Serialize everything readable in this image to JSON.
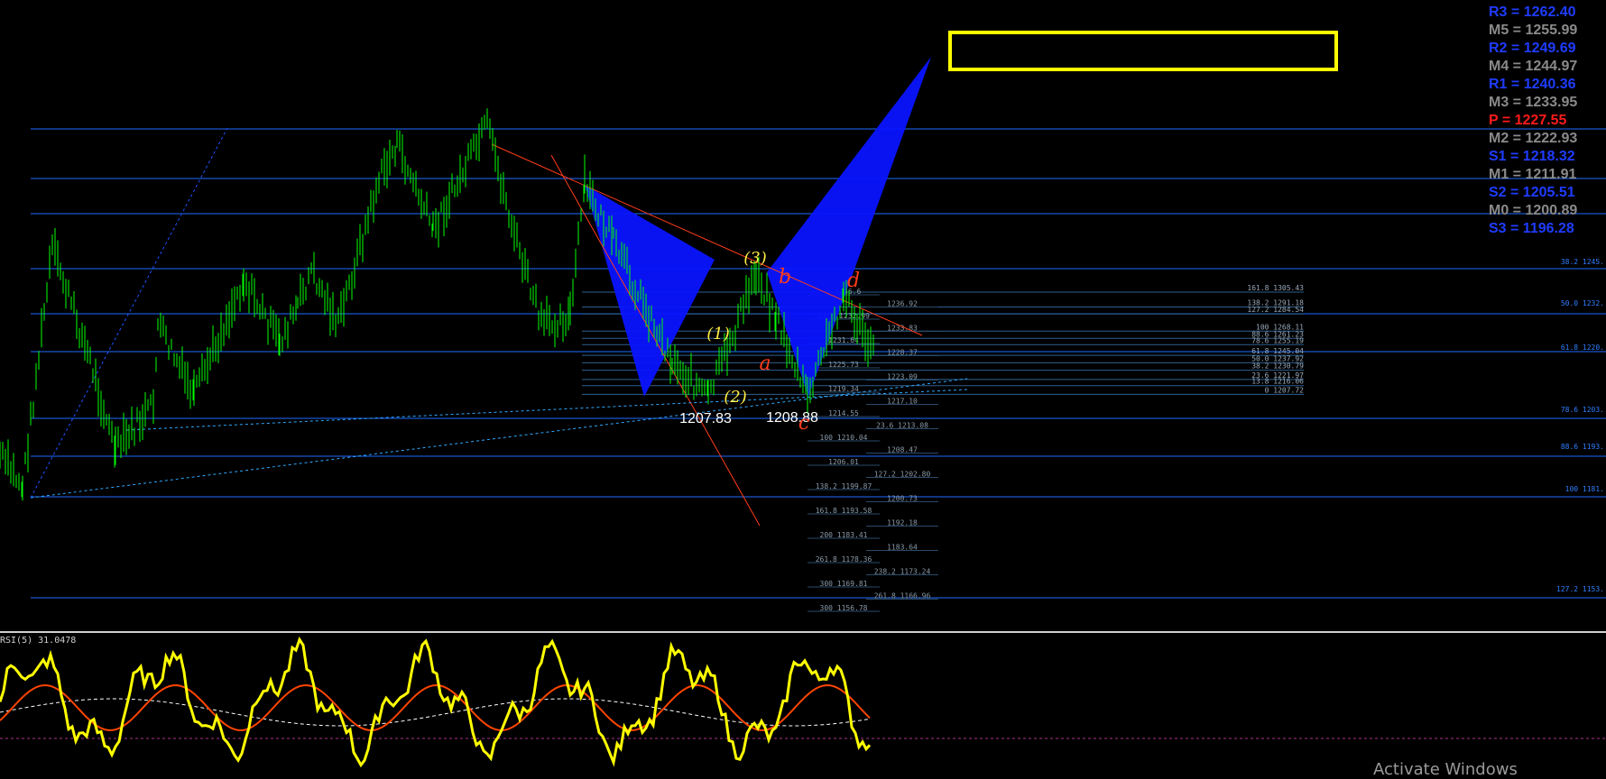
{
  "chart_data": {
    "type": "line",
    "title": "",
    "fib_levels_left": [
      "161.8 1305.43",
      "138.2 1291.18",
      "127.2 1284.54",
      "100 1268.11",
      "88.6 1261.23",
      "78.6 1255.19",
      "61.8 1245.04",
      "50.0 1237.92",
      "38.2 1230.79",
      "23.6 1221.97",
      "13.8 1216.06",
      "0 1207.72"
    ],
    "fib_levels_right": [
      "38.2 1245.",
      "50.0 1232.",
      "61.8 1220.",
      "78.6 1203.",
      "88.6 1193.",
      "100 1181.",
      "127.2 1153."
    ],
    "fib_levels_mid": [
      "0 1236.6",
      "1236.92",
      "13.8 1232.99",
      "1233.83",
      "1231.64",
      "1228.37",
      "1225.73",
      "1223.09",
      "1219.34",
      "1217.10",
      "1214.55",
      "23.6 1213.08",
      "100 1210.04",
      "1208.47",
      "1206.01",
      "127.2 1202.80",
      "138.2 1199.87",
      "1200.73",
      "161.8 1193.58",
      "1192.18",
      "200 1183.41",
      "1183.64",
      "261.8 1178.36",
      "238.2 1173.24",
      "300 1169.81",
      "261.8 1166.96",
      "300 1156.78"
    ],
    "pivots": [
      {
        "label": "R3 = 1262.40",
        "color": "#1f3cff"
      },
      {
        "label": "M5 = 1255.99",
        "color": "#8a8a8a"
      },
      {
        "label": "R2 = 1249.69",
        "color": "#1f3cff"
      },
      {
        "label": "M4 = 1244.97",
        "color": "#8a8a8a"
      },
      {
        "label": "R1 = 1240.36",
        "color": "#1f3cff"
      },
      {
        "label": "M3 = 1233.95",
        "color": "#8a8a8a"
      },
      {
        "label": "P  = 1227.55",
        "color": "#ff1a1a"
      },
      {
        "label": "M2 = 1222.93",
        "color": "#8a8a8a"
      },
      {
        "label": "S1 = 1218.32",
        "color": "#1f3cff"
      },
      {
        "label": "M1 = 1211.91",
        "color": "#8a8a8a"
      },
      {
        "label": "S2 = 1205.51",
        "color": "#1f3cff"
      },
      {
        "label": "M0 = 1200.89",
        "color": "#8a8a8a"
      },
      {
        "label": "S3 = 1196.28",
        "color": "#1f3cff"
      }
    ],
    "price_lows": [
      "1207.83",
      "1208.88"
    ],
    "wave_labels_yellow": [
      "(1)",
      "(2)",
      "(3)"
    ],
    "wave_labels_red": [
      "a",
      "b",
      "c",
      "d"
    ],
    "oscillator_label": "RSI(5) 31.0478",
    "colors": {
      "candles": "#00ff00",
      "pattern": "#0a14ff",
      "fib": "#1e6cff",
      "target_box": "#ffff00",
      "trend": "#ff3c1a",
      "rsi": "#ffff00",
      "rsi_signal": "#ff4500"
    }
  },
  "watermark": "Activate Windows"
}
